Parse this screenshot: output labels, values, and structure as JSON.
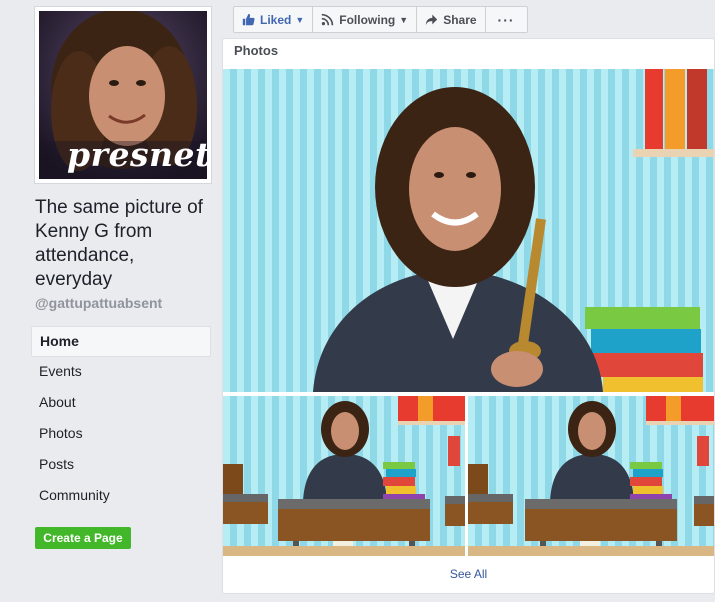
{
  "sidebar": {
    "profile_caption": "presnet",
    "page_name": "The same picture of Kenny G from attendance, everyday",
    "handle": "@gattupattuabsent",
    "nav_items": [
      {
        "label": "Home",
        "active": true
      },
      {
        "label": "Events"
      },
      {
        "label": "About"
      },
      {
        "label": "Photos"
      },
      {
        "label": "Posts"
      },
      {
        "label": "Community"
      }
    ],
    "create_page_label": "Create a Page"
  },
  "toolbar": {
    "liked_label": "Liked",
    "following_label": "Following",
    "share_label": "Share",
    "more_label": "···"
  },
  "photos": {
    "title": "Photos",
    "see_all_label": "See All"
  },
  "colors": {
    "background": "#e9ebee",
    "link": "#365899",
    "create_button": "#42b72a",
    "liked_icon": "#4267b2"
  },
  "icons": [
    "thumbs-up-icon",
    "rss-icon",
    "share-arrow-icon",
    "more-icon",
    "caret-down-icon"
  ]
}
